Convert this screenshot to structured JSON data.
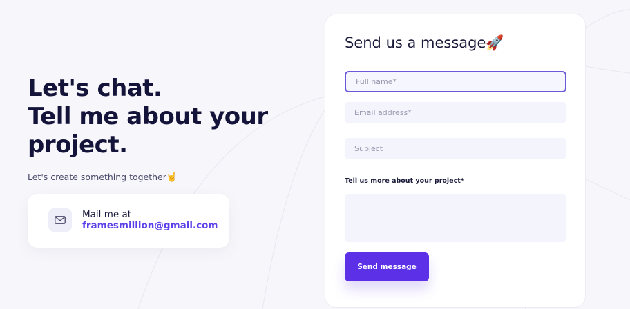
{
  "hero": {
    "line1": "Let's chat.",
    "line2": "Tell me about your",
    "line3": "project.",
    "subtitle": "Let's create something together🤘"
  },
  "contact": {
    "label": "Mail me at",
    "email": "framesmillion@gmail.com",
    "icon": "mail-icon"
  },
  "form": {
    "title": "Send us a message🚀",
    "full_name_placeholder": "Full name*",
    "email_placeholder": "Email address*",
    "subject_placeholder": "Subject",
    "message_label": "Tell us more about your project*",
    "submit_label": "Send message"
  },
  "colors": {
    "accent": "#5b30e6",
    "heading": "#14143a",
    "field_bg": "#f4f4fc",
    "page_bg": "#f7f7fb"
  }
}
